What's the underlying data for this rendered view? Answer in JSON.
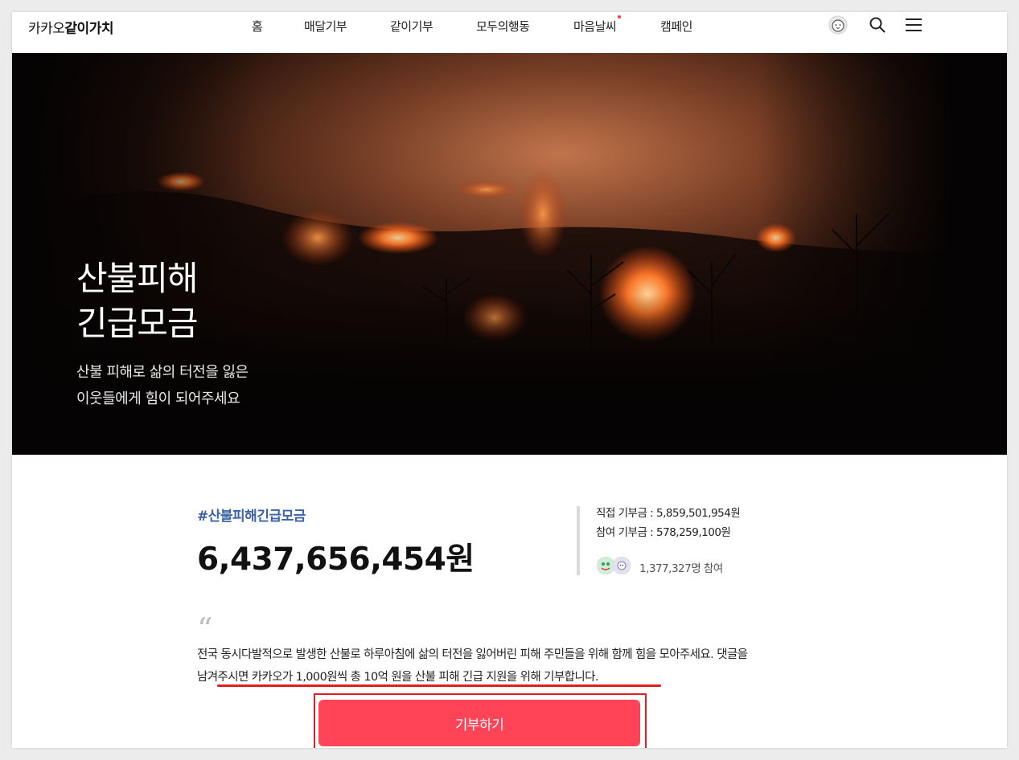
{
  "header": {
    "logo_prefix": "카카오",
    "logo_main": "같이가치",
    "nav": [
      "홈",
      "매달기부",
      "같이기부",
      "모두의행동",
      "마음날씨",
      "캠페인"
    ]
  },
  "hero": {
    "title": "산불피해\n긴급모금",
    "subtitle": "산불 피해로 삶의 터전을 잃은\n이웃들에게 힘이 되어주세요"
  },
  "stats": {
    "hashtag": "#산불피해긴급모금",
    "total": "6,437,656,454원",
    "direct": "직접 기부금 : 5,859,501,954원",
    "participation": "참여 기부금 : 578,259,100원",
    "participants": "1,377,327명 참여"
  },
  "quote": {
    "mark": "“",
    "text_part1": "전국 동시다발적으로 발생한 산불로 하루아침에 삶의 터전을 잃어버린 피해 주민들을 위해 함께 힘을 모아주세요. ",
    "text_part2": "댓글을 남겨주시면 카카오가 1,000원씩 총 10억 원을 산불 피해 긴급 지원을 위해 기부",
    "text_part3": "합니다."
  },
  "donate": {
    "label": "기부하기"
  },
  "colors": {
    "accent": "#ff4458",
    "hashtag": "#3b64a8",
    "highlight": "#e01e1e"
  },
  "icons": {
    "profile": "avatar-icon",
    "search": "search-icon",
    "menu": "hamburger-menu-icon"
  }
}
